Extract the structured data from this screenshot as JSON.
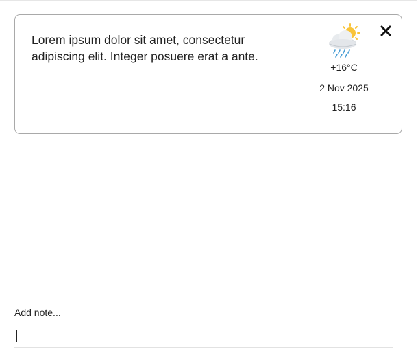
{
  "note": {
    "text": "Lorem ipsum dolor sit amet, consectetur adipiscing elit. Integer posuere erat a ante.",
    "weather_icon": "sun-behind-rain-cloud-icon",
    "temperature": "+16°C",
    "date": "2 Nov 2025",
    "time": "15:16",
    "close_icon": "close-icon"
  },
  "composer": {
    "label": "Add note...",
    "value": "",
    "placeholder": ""
  }
}
